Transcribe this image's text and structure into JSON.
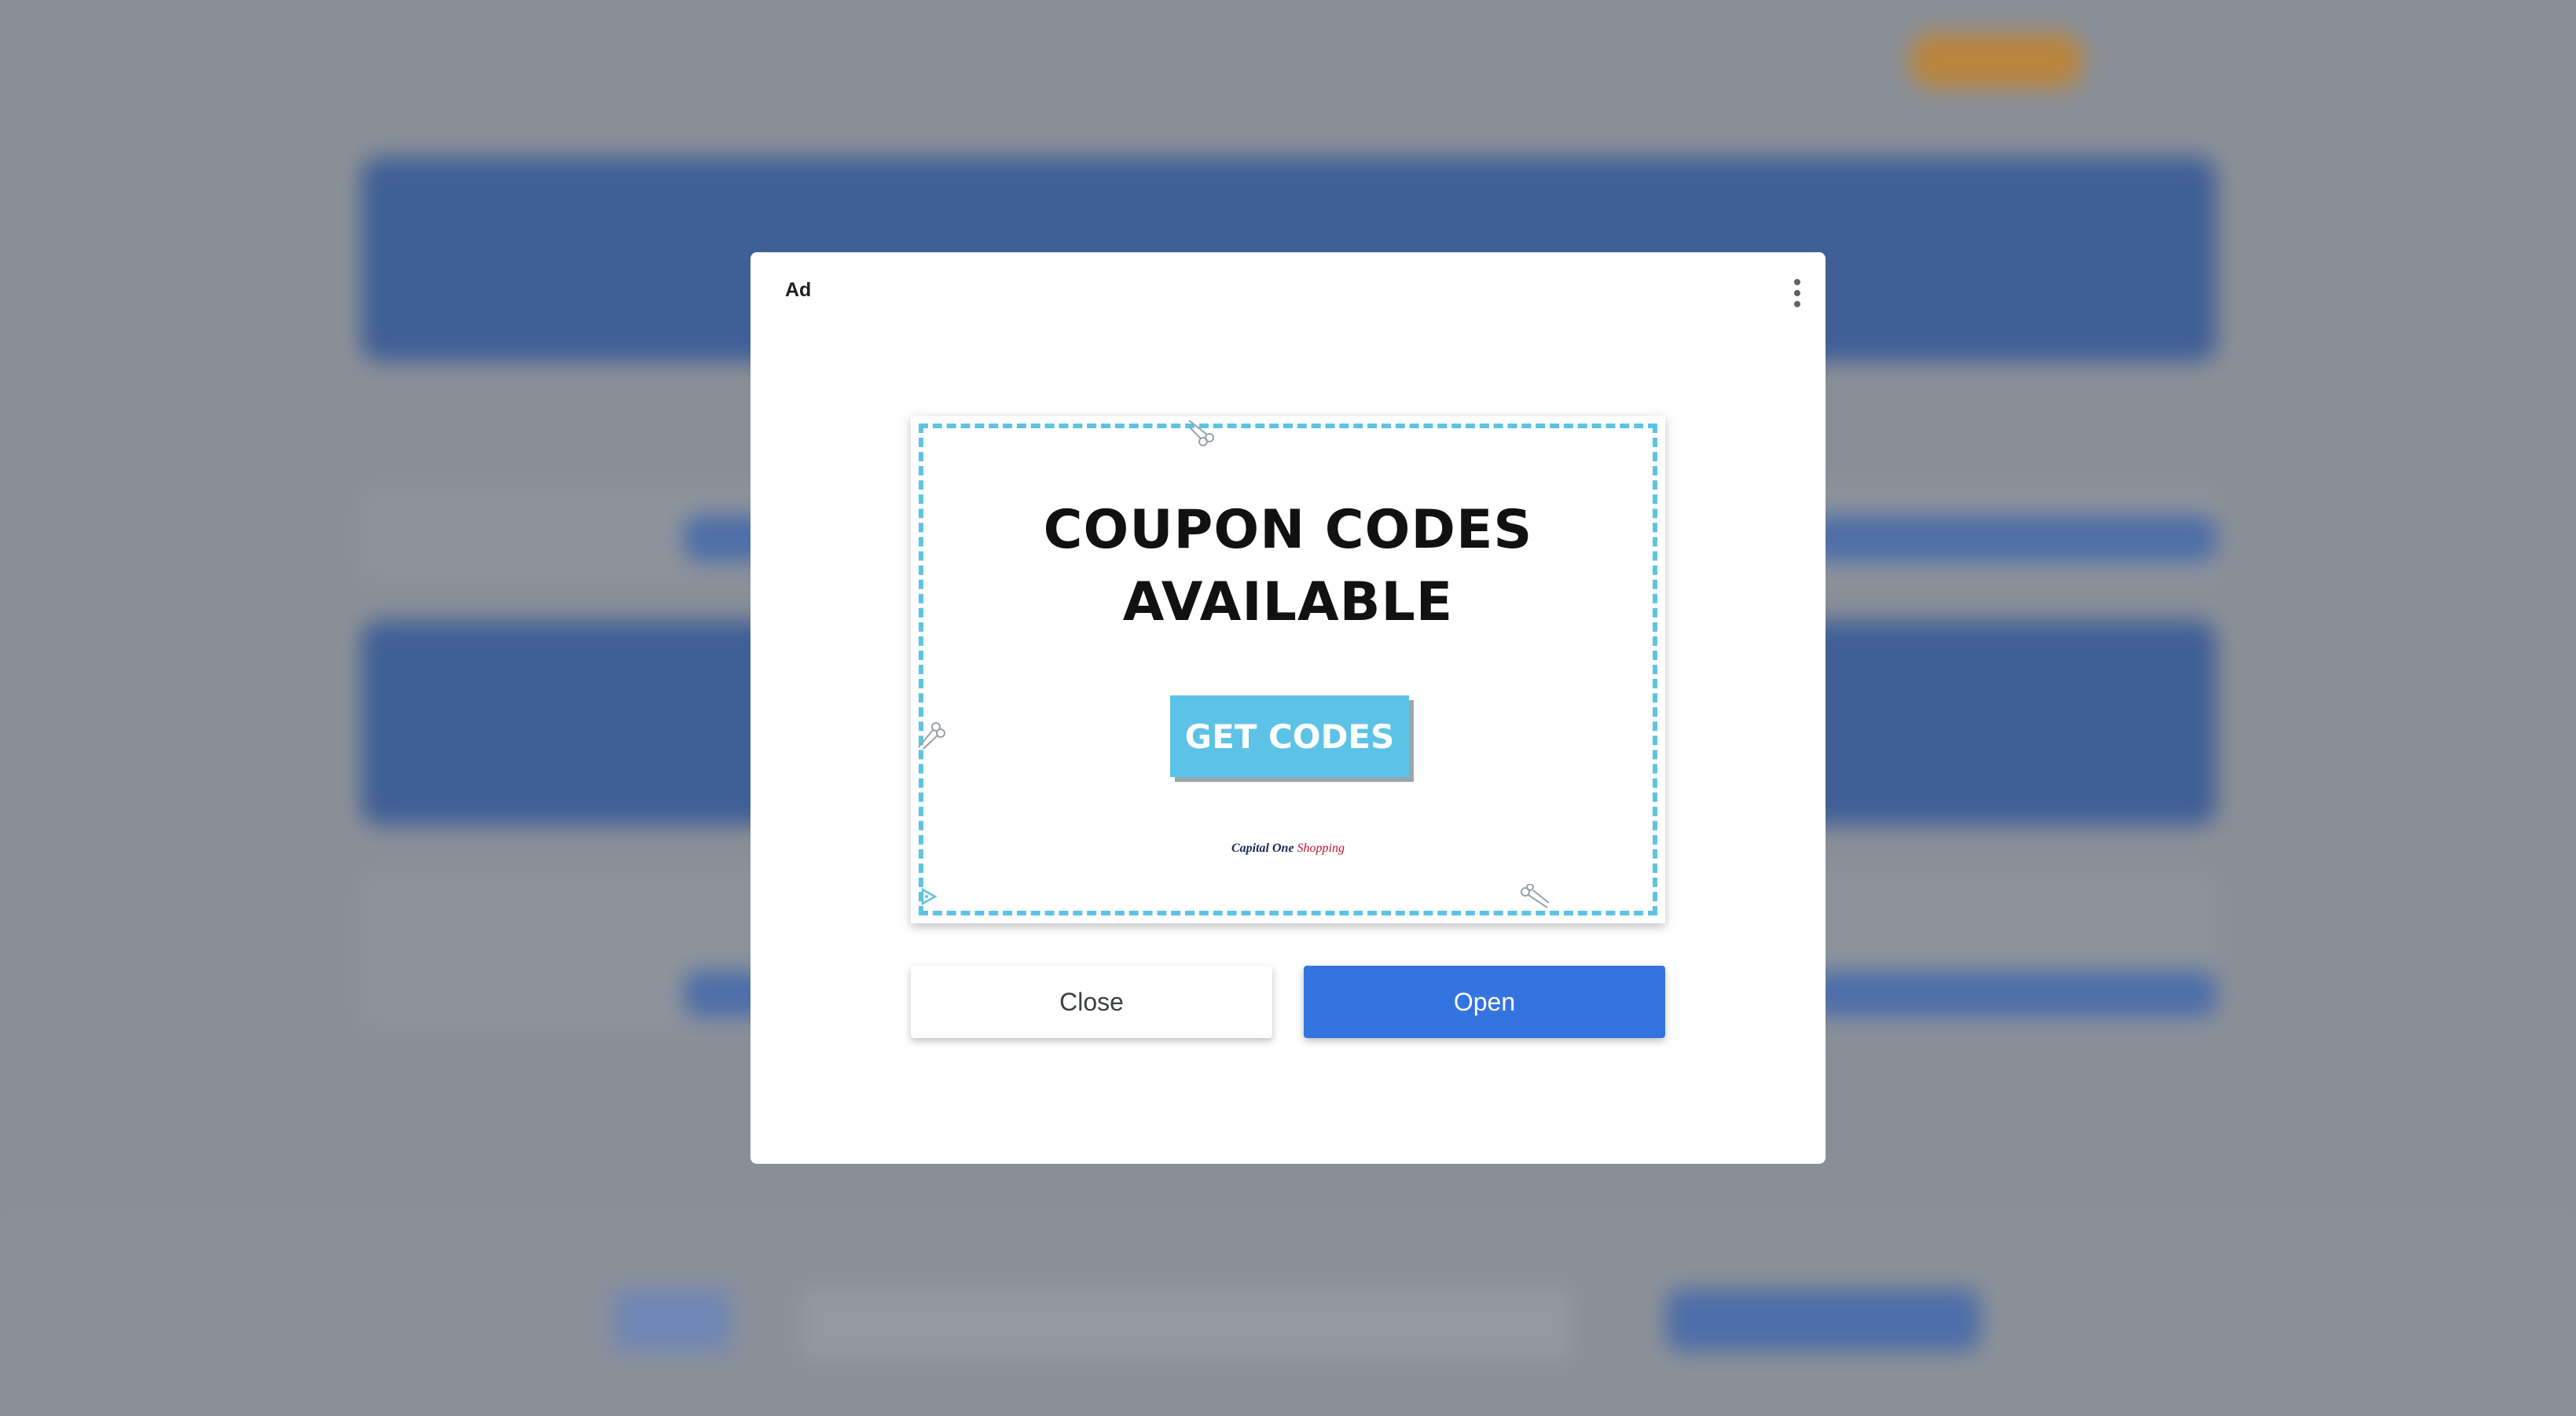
{
  "dialog": {
    "ad_label": "Ad",
    "menu_icon": "more-vert-icon"
  },
  "creative": {
    "headline_line1": "COUPON CODES",
    "headline_line2": "AVAILABLE",
    "cta_label": "GET CODES",
    "brand_part1": "Capital One",
    "brand_part2": "Shopping",
    "accent_color": "#5ec3e3",
    "adchoices_icon": "adchoices-icon",
    "scissors_icon": "scissors-icon"
  },
  "buttons": {
    "close_label": "Close",
    "open_label": "Open",
    "open_color": "#3474e0"
  }
}
